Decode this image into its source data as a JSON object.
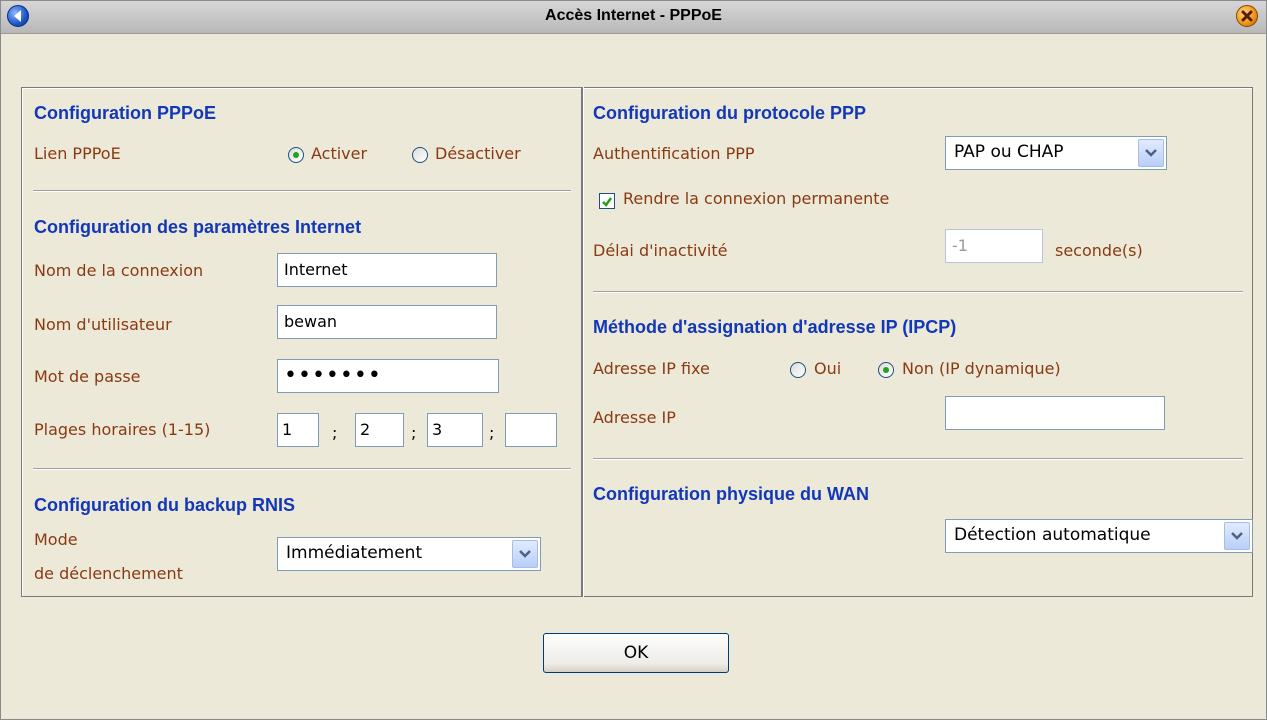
{
  "window": {
    "title": "Accès Internet - PPPoE"
  },
  "icons": {
    "back": "back-arrow-icon",
    "close": "close-icon"
  },
  "colors": {
    "section_title": "#1238b8",
    "label": "#8a3a12",
    "background": "#ece9d8"
  },
  "left": {
    "pppoe": {
      "title": "Configuration PPPoE",
      "link_label": "Lien PPPoE",
      "enable_label": "Activer",
      "disable_label": "Désactiver",
      "selected": "Activer"
    },
    "internet": {
      "title": "Configuration des paramètres Internet",
      "connection_name_label": "Nom de la connexion",
      "connection_name_value": "Internet",
      "username_label": "Nom d'utilisateur",
      "username_value": "bewan",
      "password_label": "Mot de passe",
      "password_value": "•••••••",
      "timeslots_label": "Plages horaires (1-15)",
      "timeslot_1": "1",
      "timeslot_2": "2",
      "timeslot_3": "3",
      "timeslot_4": "",
      "separator": ";"
    },
    "backup": {
      "title": "Configuration du backup RNIS",
      "mode_label_1": "Mode",
      "mode_label_2": "de déclenchement",
      "mode_value": "Immédiatement"
    }
  },
  "right": {
    "ppp": {
      "title": "Configuration du protocole PPP",
      "auth_label": "Authentification PPP",
      "auth_value": "PAP ou CHAP",
      "permanent_label": "Rendre la connexion permanente",
      "permanent_checked": true,
      "idle_label": "Délai d'inactivité",
      "idle_value": "-1",
      "idle_unit": "seconde(s)"
    },
    "ipcp": {
      "title": "Méthode d'assignation d'adresse IP (IPCP)",
      "fixed_ip_label": "Adresse IP fixe",
      "yes_label": "Oui",
      "no_label": "Non (IP dynamique)",
      "selected": "Non (IP dynamique)",
      "ip_label": "Adresse IP",
      "ip_value": ""
    },
    "wan": {
      "title": "Configuration physique du WAN",
      "mode_value": "Détection automatique"
    }
  },
  "footer": {
    "ok_label": "OK"
  }
}
